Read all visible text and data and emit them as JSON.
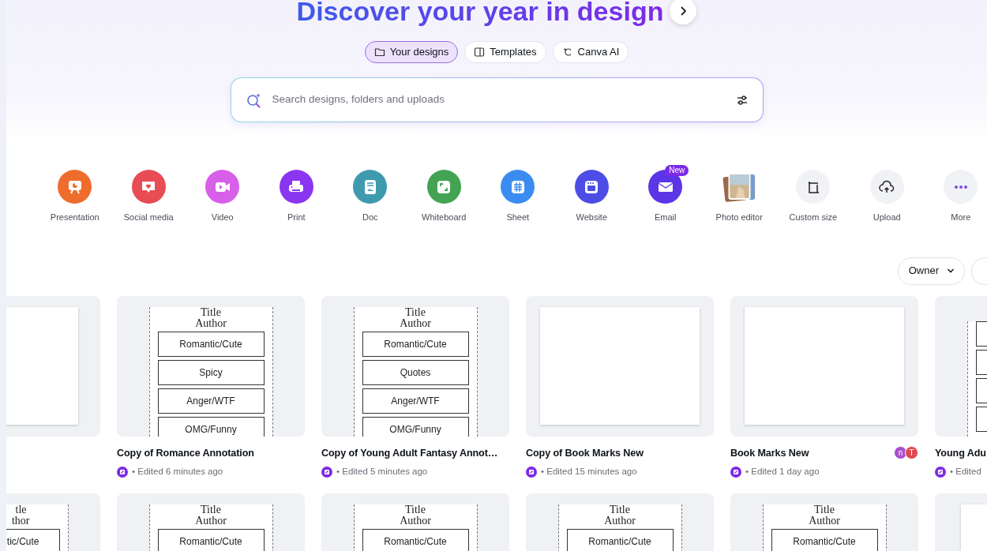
{
  "heading": {
    "title": "Discover your year in design"
  },
  "scopes": [
    {
      "label": "Your designs",
      "selected": true
    },
    {
      "label": "Templates",
      "selected": false
    },
    {
      "label": "Canva AI",
      "selected": false
    }
  ],
  "search": {
    "placeholder": "Search designs, folders and uploads"
  },
  "design_types": [
    {
      "label": "Presentation",
      "kind": "circle",
      "color": "#ef6d2c"
    },
    {
      "label": "Social media",
      "kind": "circle",
      "color": "#e84c55"
    },
    {
      "label": "Video",
      "kind": "circle",
      "color": "#d85fe8"
    },
    {
      "label": "Print",
      "kind": "circle",
      "color": "#8a36f0"
    },
    {
      "label": "Doc",
      "kind": "circle",
      "color": "#3f9aae"
    },
    {
      "label": "Whiteboard",
      "kind": "circle",
      "color": "#43a353"
    },
    {
      "label": "Sheet",
      "kind": "circle",
      "color": "#3b8cf0"
    },
    {
      "label": "Website",
      "kind": "circle",
      "color": "#4d4de6"
    },
    {
      "label": "Email",
      "kind": "circle",
      "color": "#5c35e6",
      "badge": "New"
    },
    {
      "label": "Photo editor",
      "kind": "picture"
    },
    {
      "label": "Custom size",
      "kind": "plain"
    },
    {
      "label": "Upload",
      "kind": "plain"
    },
    {
      "label": "More",
      "kind": "plain"
    }
  ],
  "filter": {
    "label": "Owner"
  },
  "designs": [
    {
      "thumbnail": {
        "kind": "blank_cut"
      }
    },
    {
      "thumbnail": {
        "kind": "bookmark",
        "title": "Title",
        "author": "Author",
        "labels": [
          "Romantic/Cute",
          "Spicy",
          "Anger/WTF",
          "OMG/Funny"
        ]
      },
      "title": "Copy of Romance Annotation",
      "meta": "• Edited 6 minutes ago"
    },
    {
      "thumbnail": {
        "kind": "bookmark",
        "title": "Title",
        "author": "Author",
        "labels": [
          "Romantic/Cute",
          "Quotes",
          "Anger/WTF",
          "OMG/Funny"
        ]
      },
      "title": "Copy of Young Adult Fantasy Annot…",
      "meta": "• Edited 5 minutes ago"
    },
    {
      "thumbnail": {
        "kind": "blank"
      },
      "title": "Copy of Book Marks New",
      "meta": "• Edited 15 minutes ago"
    },
    {
      "thumbnail": {
        "kind": "blank"
      },
      "title": "Book Marks New",
      "meta": "• Edited 1 day ago",
      "collaborators": [
        {
          "initial": "n",
          "color": "#a94fd0"
        },
        {
          "initial": "T",
          "color": "#e0484f"
        }
      ]
    },
    {
      "thumbnail": {
        "kind": "bookmark_edge"
      },
      "title": "Young Adu",
      "meta": "• Edited"
    }
  ],
  "designs_row_2": [
    {
      "thumbnail": {
        "kind": "bookmark_cut",
        "title": "tle",
        "author": "thor",
        "labels": [
          "tic/Cute"
        ]
      }
    },
    {
      "thumbnail": {
        "kind": "bookmark",
        "title": "Title",
        "author": "Author",
        "labels": [
          "Romantic/Cute"
        ]
      }
    },
    {
      "thumbnail": {
        "kind": "bookmark",
        "title": "Title",
        "author": "Author",
        "labels": [
          "Romantic/Cute"
        ]
      }
    },
    {
      "thumbnail": {
        "kind": "bookmark",
        "title": "Title",
        "author": "Author",
        "labels": [
          "Romantic/Cute"
        ]
      }
    },
    {
      "thumbnail": {
        "kind": "bookmark",
        "title": "Title",
        "author": "Author",
        "labels": [
          "Romantic/Cute"
        ]
      }
    },
    {
      "thumbnail": {
        "kind": "blank_edge"
      }
    }
  ]
}
